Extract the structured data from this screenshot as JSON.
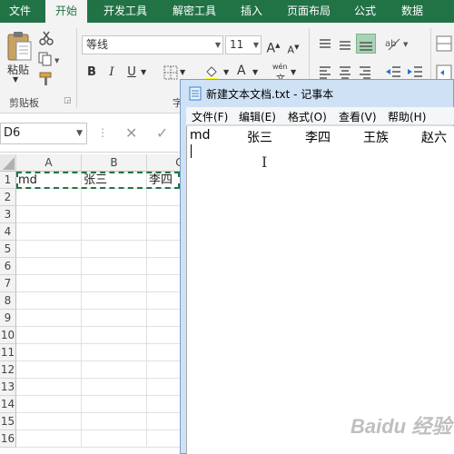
{
  "colors": {
    "excel_green": "#217346",
    "ribbon_bg": "#f3f3f3",
    "notepad_frame": "#cfe1f5"
  },
  "excel": {
    "tabs": [
      "文件",
      "开始",
      "开发工具",
      "解密工具",
      "插入",
      "页面布局",
      "公式",
      "数据"
    ],
    "active_tab": "开始",
    "ribbon": {
      "paste_label": "粘贴",
      "clipboard_group": "剪贴板",
      "font_group_partial": "字",
      "font_name": "等线",
      "font_size": "11",
      "grow_font": "A",
      "shrink_font": "A",
      "bold": "B",
      "italic": "I",
      "underline": "U",
      "font_color": "A",
      "phonetic": "wén"
    },
    "name_box": "D6",
    "columns": [
      "A",
      "B",
      "C"
    ],
    "rows": [
      "1",
      "2",
      "3",
      "4",
      "5",
      "6",
      "7",
      "8",
      "9",
      "10",
      "11",
      "12",
      "13",
      "14",
      "15",
      "16"
    ],
    "cells": {
      "A1": "md",
      "B1": "张三",
      "C1": "李四"
    }
  },
  "notepad": {
    "title": "新建文本文档.txt - 记事本",
    "menu": [
      "文件(F)",
      "编辑(E)",
      "格式(O)",
      "查看(V)",
      "帮助(H)"
    ],
    "content": [
      "md",
      "张三",
      "李四",
      "王族",
      "赵六"
    ]
  },
  "watermark": "Baidu 经验"
}
